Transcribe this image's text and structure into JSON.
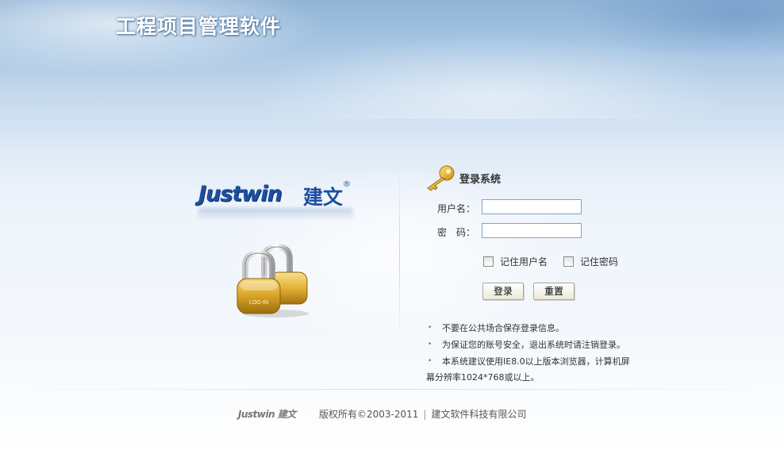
{
  "app": {
    "title": "工程项目管理软件"
  },
  "logo": {
    "brand": "Justwin",
    "brand_cn": "建文",
    "reg_mark": "®",
    "lock_text": "LOG-IN"
  },
  "login": {
    "heading": "登录系统",
    "username_label": "用户名：",
    "username_value": "",
    "password_label": "密　码：",
    "password_value": "",
    "remember_username_label": "记住用户名",
    "remember_password_label": "记住密码",
    "login_button": "登录",
    "reset_button": "重置"
  },
  "tips": {
    "items": [
      "不要在公共场合保存登录信息。",
      "为保证您的账号安全，退出系统时请注销登录。",
      "本系统建议使用IE8.0以上版本浏览器，计算机屏"
    ],
    "last_continued": "幕分辨率1024*768或以上。"
  },
  "footer": {
    "logo_text": "Justwin 建文",
    "copyright": "版权所有©2003-2011",
    "separator": "|",
    "company": "建文软件科技有限公司"
  },
  "colors": {
    "brand_blue": "#1c4fa0",
    "gold": "#d9a520",
    "input_border": "#7fa7c7"
  }
}
